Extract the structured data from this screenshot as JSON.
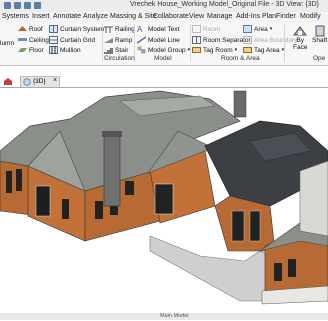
{
  "window": {
    "title": "Vrechek House_Working Model_Original File - 3D View: {3D}"
  },
  "ribbon_tabs": [
    "Systems",
    "Insert",
    "Annotate",
    "Analyze",
    "Massing & Site",
    "Collaborate",
    "View",
    "Manage",
    "Add-Ins",
    "PlanFinder",
    "Modify"
  ],
  "ribbon": {
    "build": {
      "column_label": "lumn",
      "roof": "Roof",
      "ceiling": "Ceiling",
      "floor": "Floor",
      "curtain_system": "Curtain System",
      "curtain_grid": "Curtain Grid",
      "mullion": "Mullion"
    },
    "circulation": {
      "railing": "Railing",
      "ramp": "Ramp",
      "stair": "Stair",
      "group_label": "Circulation"
    },
    "model": {
      "model_text": "Model Text",
      "model_line": "Model Line",
      "model_group": "Model Group",
      "group_label": "Model"
    },
    "room_area": {
      "room": "Room",
      "room_separator": "Room Separator",
      "tag_room": "Tag Room",
      "area": "Area",
      "area_boundary": "Area Boundary",
      "tag_area": "Tag Area",
      "group_label": "Room & Area"
    },
    "opening": {
      "by_face": "By",
      "face": "Face",
      "shaft": "Shaft",
      "open": "Ope"
    }
  },
  "view_tab": {
    "label": "{3D}"
  },
  "status": {
    "text": "Main Model"
  },
  "colors": {
    "brick": "#b86a35",
    "roof": "#8a8f8a",
    "dark_roof": "#3c4045",
    "trim": "#e8e8e2"
  }
}
